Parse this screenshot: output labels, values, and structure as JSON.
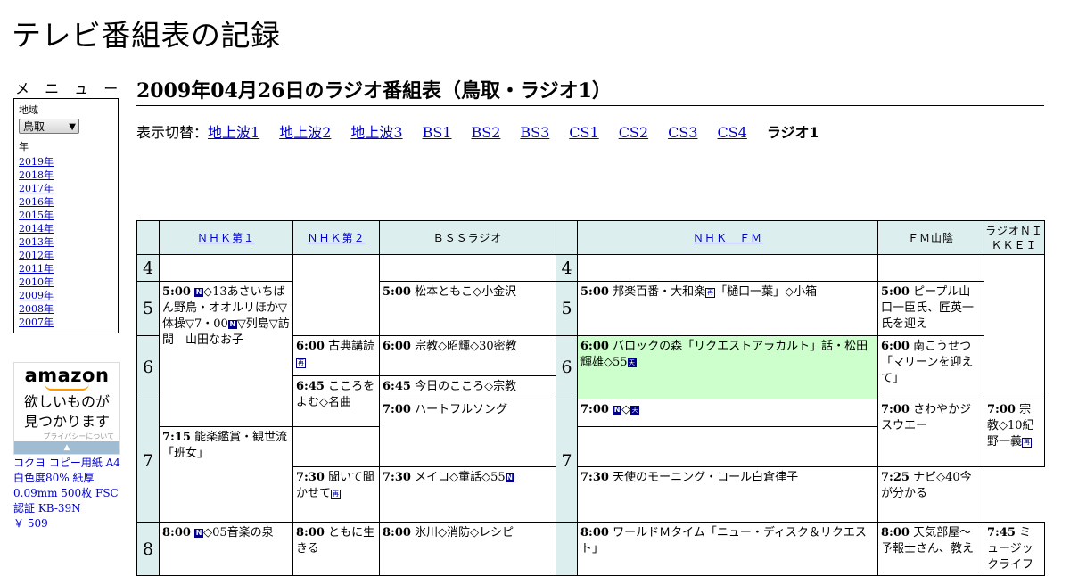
{
  "site": {
    "title": "テレビ番組表の記録"
  },
  "menu": {
    "heading": "メ ニ ュ ー",
    "region_label": "地域",
    "region_value": "鳥取",
    "year_label": "年",
    "years": [
      "2019年",
      "2018年",
      "2017年",
      "2016年",
      "2015年",
      "2014年",
      "2013年",
      "2012年",
      "2011年",
      "2010年",
      "2009年",
      "2008年",
      "2007年"
    ]
  },
  "ad": {
    "brand": "amazon",
    "line1": "欲しいものが",
    "line2": "見つかります",
    "privacy": "プライバシーについて",
    "product_name": "コクヨ コピー用紙 A4 白色度80% 紙厚 0.09mm 500枚 FSC認証 KB-39N",
    "product_price": "￥ 509"
  },
  "page": {
    "title": "2009年04月26日のラジオ番組表（鳥取・ラジオ1）",
    "switch_label": "表示切替：",
    "switch_links": [
      "地上波1",
      "地上波2",
      "地上波3",
      "BS1",
      "BS2",
      "BS3",
      "CS1",
      "CS2",
      "CS3",
      "CS4"
    ],
    "switch_current": "ラジオ1"
  },
  "grid": {
    "channels": [
      "ＮＨＫ第１",
      "ＮＨＫ第２",
      "ＢＳＳラジオ",
      "ＮＨＫ　ＦＭ",
      "ＦＭ山陰",
      "ラジオＮＩＫＫＥＩ"
    ],
    "hours": [
      "4",
      "5",
      "6",
      "7",
      "8"
    ],
    "p1": {
      "time": "5:00",
      "text_a": "◇13あさいちばん野鳥・オオルリほか▽体操▽7・00",
      "text_b": "▽列島▽訪問　山田なお子"
    },
    "p2": {
      "time": "6:00",
      "text": "古典講読"
    },
    "p3": {
      "time": "6:45",
      "text": "こころをよむ◇名曲"
    },
    "p4": {
      "time": "7:30",
      "text": "聞いて聞かせて"
    },
    "p5": {
      "time": "8:00",
      "text": "◇05音楽の泉"
    },
    "p6": {
      "time": "8:00",
      "text": "ともに生きる"
    },
    "b1": {
      "time": "5:00",
      "text": "松本ともこ◇小金沢"
    },
    "b2": {
      "time": "6:00",
      "text": "宗教◇昭輝◇30密教"
    },
    "b3": {
      "time": "6:45",
      "text": "今日のこころ◇宗教"
    },
    "b4": {
      "time": "7:00",
      "text": "ハートフルソング"
    },
    "b5": {
      "time": "7:30",
      "text": "メイコ◇童話◇55"
    },
    "b6": {
      "time": "8:00",
      "text": "氷川◇消防◇レシピ"
    },
    "f1": {
      "time": "5:00",
      "text_a": "邦楽百番・大和楽",
      "text_b": "「樋口一葉」◇小箱"
    },
    "f2": {
      "time": "6:00",
      "text": "バロックの森「リクエストアラカルト」話・松田輝雄◇55"
    },
    "f3": {
      "time": "7:00",
      "text": "◇"
    },
    "f4": {
      "time": "7:15",
      "text": "能楽鑑賞・観世流「班女」"
    },
    "f5": {
      "time": "8:00",
      "text": "ワールドＭタイム「ニュー・ディスク＆リクエスト」"
    },
    "s1": {
      "time": "5:00",
      "text": "ピープル山口一臣氏、匠英一氏を迎え"
    },
    "s2": {
      "time": "6:00",
      "text": "南こうせつ「マリーンを迎えて」"
    },
    "s3": {
      "time": "7:00",
      "text": "さわやかジスウエー"
    },
    "s4": {
      "time": "7:30",
      "text": "天使のモーニング・コール白倉律子"
    },
    "s5": {
      "time": "8:00",
      "text": "天気部屋～予報士さん、教え"
    },
    "n1": {
      "time": "7:00",
      "text": "宗教◇10紀野一義"
    },
    "n2": {
      "time": "7:25",
      "text": "ナビ◇40今が分かる"
    },
    "n3": {
      "time": "7:45",
      "text": "ミュージックライフ"
    },
    "icons": {
      "news": "N",
      "ten": "天",
      "re": "再"
    }
  }
}
